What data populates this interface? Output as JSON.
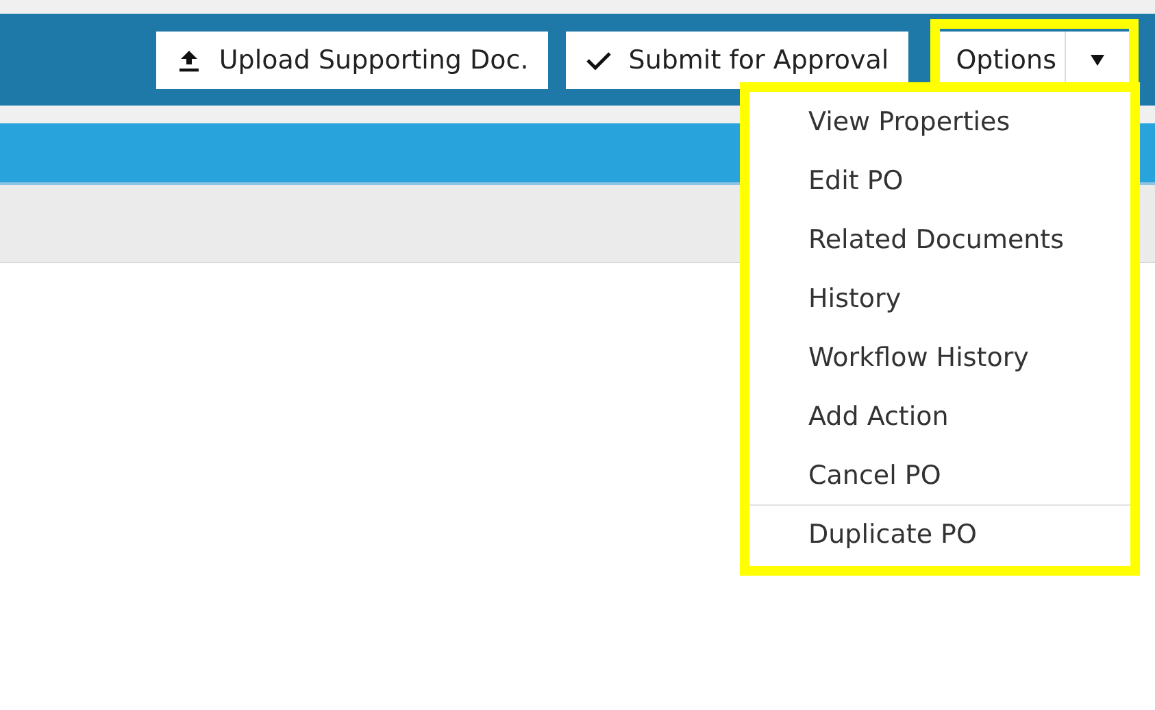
{
  "toolbar": {
    "buttons": [
      {
        "kind": "upload",
        "label": "Upload Supporting Doc."
      },
      {
        "kind": "check",
        "label": "Submit for Approval"
      }
    ],
    "options": {
      "label": "Options",
      "expanded": true,
      "highlighted": true
    }
  },
  "options_menu": {
    "highlighted": true,
    "items": [
      {
        "label": "View Properties",
        "separator_before": false
      },
      {
        "label": "Edit PO",
        "separator_before": false
      },
      {
        "label": "Related Documents",
        "separator_before": false
      },
      {
        "label": "History",
        "separator_before": false
      },
      {
        "label": "Workflow History",
        "separator_before": false
      },
      {
        "label": "Add Action",
        "separator_before": false
      },
      {
        "label": "Cancel PO",
        "separator_before": false
      },
      {
        "label": "Duplicate PO",
        "separator_before": true
      }
    ]
  }
}
